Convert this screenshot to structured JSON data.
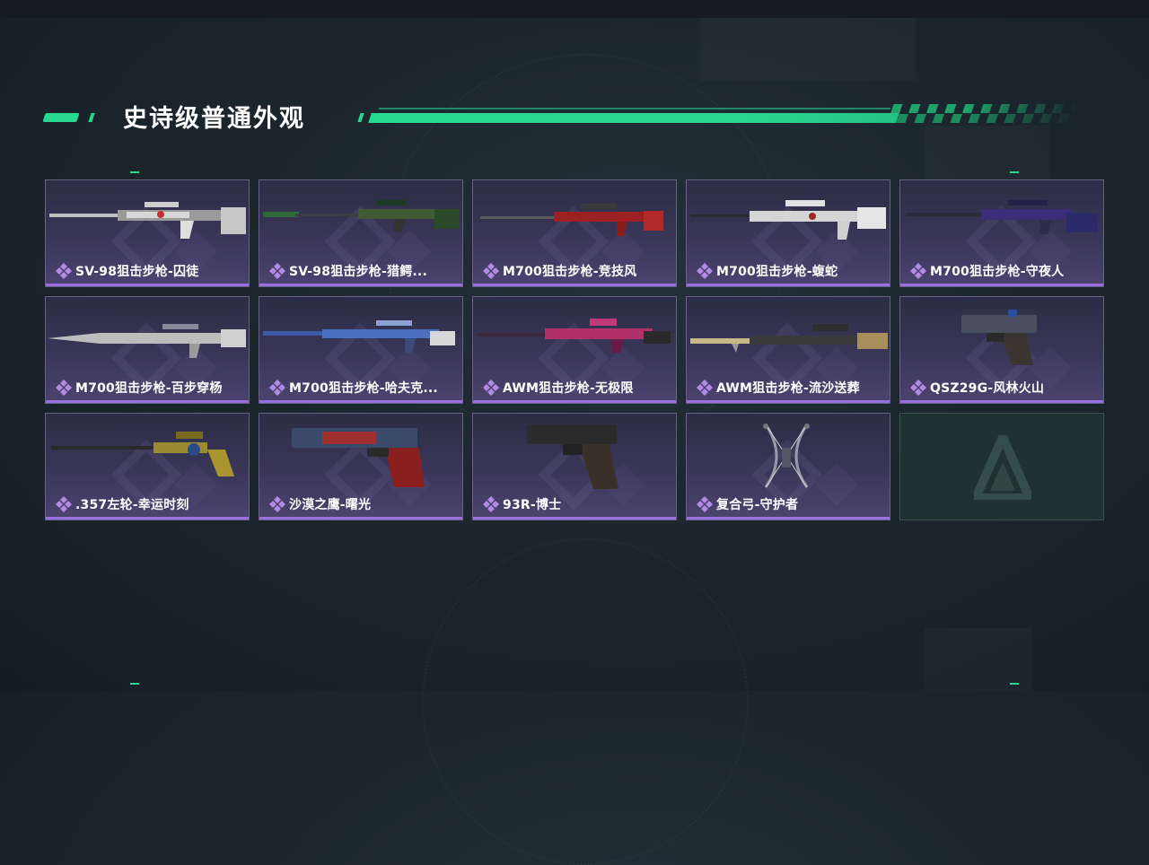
{
  "section": {
    "title": "史诗级普通外观"
  },
  "colors": {
    "accent": "#27d98e",
    "rarity": "#9a6fe0",
    "card_bg": "#3a3658"
  },
  "items": [
    {
      "name": "SV-98狙击步枪-囚徒",
      "icon": "sniper-rifle-icon"
    },
    {
      "name": "SV-98狙击步枪-猎鳄...",
      "icon": "sniper-rifle-icon"
    },
    {
      "name": "M700狙击步枪-竞技风",
      "icon": "sniper-rifle-icon"
    },
    {
      "name": "M700狙击步枪-蝮蛇",
      "icon": "sniper-rifle-icon"
    },
    {
      "name": "M700狙击步枪-守夜人",
      "icon": "sniper-rifle-icon"
    },
    {
      "name": "M700狙击步枪-百步穿杨",
      "icon": "sniper-rifle-icon"
    },
    {
      "name": "M700狙击步枪-哈夫克...",
      "icon": "sniper-rifle-icon"
    },
    {
      "name": "AWM狙击步枪-无极限",
      "icon": "sniper-rifle-icon"
    },
    {
      "name": "AWM狙击步枪-流沙送葬",
      "icon": "sniper-rifle-icon"
    },
    {
      "name": "QSZ29G-风林火山",
      "icon": "pistol-icon"
    },
    {
      "name": ".357左轮-幸运时刻",
      "icon": "revolver-icon"
    },
    {
      "name": "沙漠之鹰-曙光",
      "icon": "pistol-icon"
    },
    {
      "name": "93R-博士",
      "icon": "pistol-icon"
    },
    {
      "name": "复合弓-守护者",
      "icon": "compound-bow-icon"
    }
  ]
}
